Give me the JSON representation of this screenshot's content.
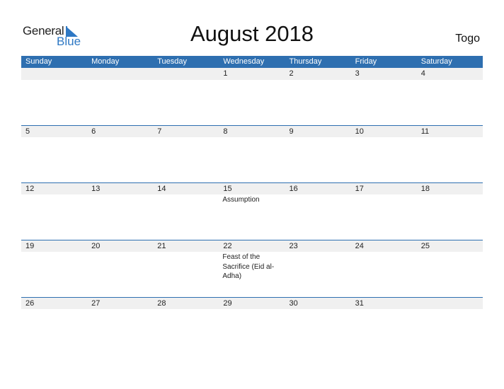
{
  "logo": {
    "word1": "General",
    "word2": "Blue",
    "brand_color": "#2e78c4"
  },
  "title": "August 2018",
  "country": "Togo",
  "colors": {
    "header_bg": "#2e6fb0",
    "strip_bg": "#f0f0f0"
  },
  "weekdays": [
    "Sunday",
    "Monday",
    "Tuesday",
    "Wednesday",
    "Thursday",
    "Friday",
    "Saturday"
  ],
  "weeks": [
    [
      {
        "day": ""
      },
      {
        "day": ""
      },
      {
        "day": ""
      },
      {
        "day": "1"
      },
      {
        "day": "2"
      },
      {
        "day": "3"
      },
      {
        "day": "4"
      }
    ],
    [
      {
        "day": "5"
      },
      {
        "day": "6"
      },
      {
        "day": "7"
      },
      {
        "day": "8"
      },
      {
        "day": "9"
      },
      {
        "day": "10"
      },
      {
        "day": "11"
      }
    ],
    [
      {
        "day": "12"
      },
      {
        "day": "13"
      },
      {
        "day": "14"
      },
      {
        "day": "15",
        "event": "Assumption"
      },
      {
        "day": "16"
      },
      {
        "day": "17"
      },
      {
        "day": "18"
      }
    ],
    [
      {
        "day": "19"
      },
      {
        "day": "20"
      },
      {
        "day": "21"
      },
      {
        "day": "22",
        "event": "Feast of the Sacrifice (Eid al-Adha)"
      },
      {
        "day": "23"
      },
      {
        "day": "24"
      },
      {
        "day": "25"
      }
    ],
    [
      {
        "day": "26"
      },
      {
        "day": "27"
      },
      {
        "day": "28"
      },
      {
        "day": "29"
      },
      {
        "day": "30"
      },
      {
        "day": "31"
      },
      {
        "day": ""
      }
    ]
  ]
}
